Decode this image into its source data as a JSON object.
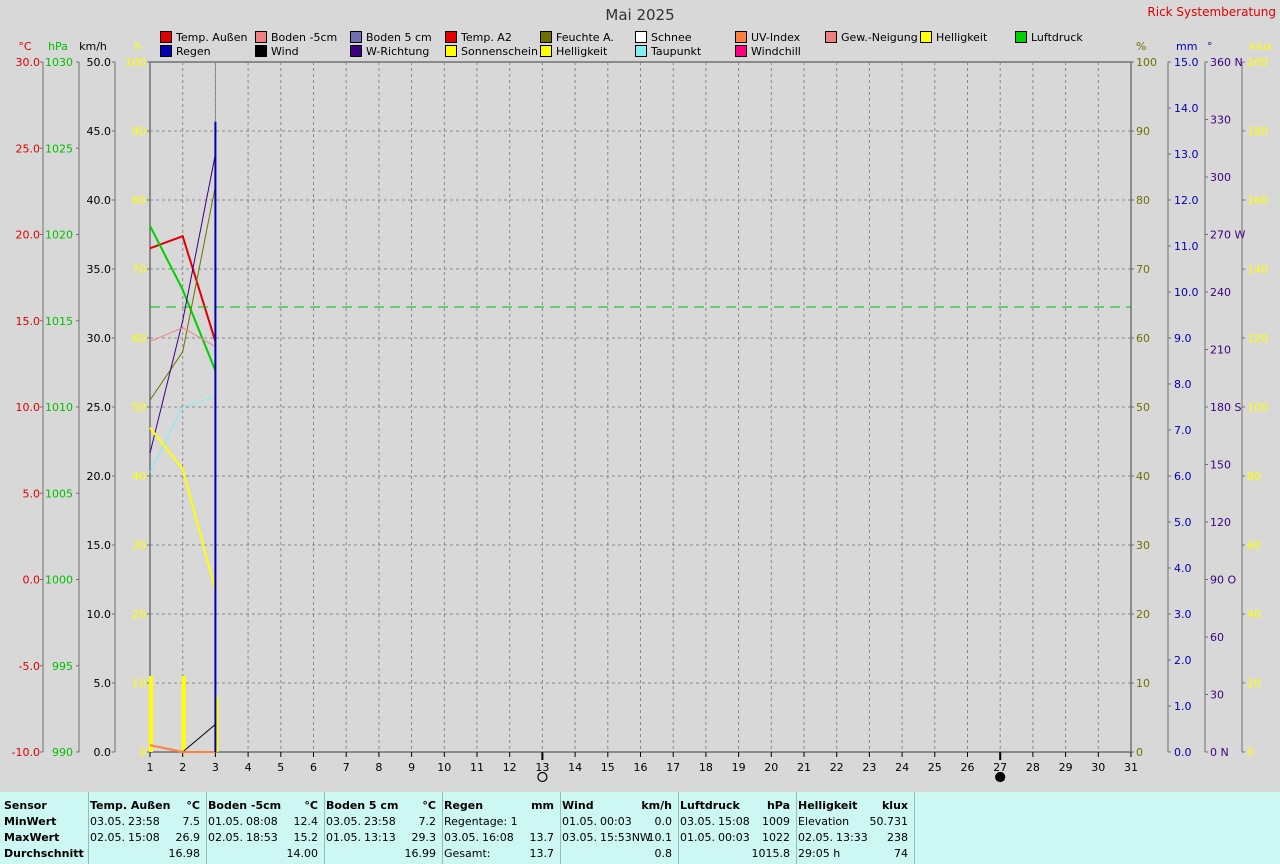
{
  "title": "Mai 2025",
  "brand": "Rick Systemberatung",
  "legend": [
    {
      "label": "Temp. Außen",
      "color": "#e00000"
    },
    {
      "label": "Regen",
      "color": "#0000b0"
    },
    {
      "label": "Boden -5cm",
      "color": "#f08080"
    },
    {
      "label": "Wind",
      "color": "#000000"
    },
    {
      "label": "Boden 5 cm",
      "color": "#7070b0"
    },
    {
      "label": "W-Richtung",
      "color": "#3c0080"
    },
    {
      "label": "Temp. A2",
      "color": "#e00000"
    },
    {
      "label": "Sonnenschein",
      "color": "#ffff00"
    },
    {
      "label": "Feuchte A.",
      "color": "#707000"
    },
    {
      "label": "Helligkeit",
      "color": "#ffff00"
    },
    {
      "label": "Schnee",
      "color": "#ffffff"
    },
    {
      "label": "Taupunkt",
      "color": "#80f0f0"
    },
    {
      "label": "UV-Index",
      "color": "#ff8040"
    },
    {
      "label": "Windchill",
      "color": "#ff0080"
    },
    {
      "label": "Gew.-Neigung",
      "color": "#f08080"
    },
    {
      "label": "Helligkeit",
      "color": "#ffff00"
    },
    {
      "label": "Luftdruck",
      "color": "#00d000"
    }
  ],
  "chart_data": {
    "type": "line",
    "title": "Mai 2025",
    "x": [
      1,
      2,
      3
    ],
    "x_ticks": [
      1,
      2,
      3,
      4,
      5,
      6,
      7,
      8,
      9,
      10,
      11,
      12,
      13,
      14,
      15,
      16,
      17,
      18,
      19,
      20,
      21,
      22,
      23,
      24,
      25,
      26,
      27,
      28,
      29,
      30,
      31
    ],
    "x_range": [
      1,
      31
    ],
    "grid": true,
    "moon_markers": [
      {
        "day": 13,
        "phase": "full"
      },
      {
        "day": 27,
        "phase": "new"
      }
    ],
    "axes": {
      "temp": {
        "unit": "°C",
        "range": [
          -10,
          30
        ],
        "ticks": [
          "30.0",
          "25.0",
          "20.0",
          "15.0",
          "10.0",
          "5.0",
          "0.0",
          "-5.0",
          "-10.0"
        ],
        "color": "#e00000"
      },
      "pressure": {
        "unit": "hPa",
        "range": [
          990,
          1030
        ],
        "ticks": [
          "1030",
          "1025",
          "1020",
          "1015",
          "1010",
          "1005",
          "1000",
          "995",
          "990"
        ],
        "color": "#00c000"
      },
      "wind": {
        "unit": "km/h",
        "range": [
          0,
          50
        ],
        "ticks": [
          "50.0",
          "45.0",
          "40.0",
          "35.0",
          "30.0",
          "25.0",
          "20.0",
          "15.0",
          "10.0",
          "5.0",
          "0.0"
        ],
        "color": "#000000"
      },
      "sun": {
        "unit": "h",
        "range": [
          0,
          100
        ],
        "ticks": [
          "100",
          "90",
          "80",
          "70",
          "60",
          "50",
          "40",
          "30",
          "20",
          "10",
          "0"
        ],
        "color": "#ffff00"
      },
      "humidity": {
        "unit": "%",
        "range": [
          0,
          100
        ],
        "ticks": [
          "100",
          "90",
          "80",
          "70",
          "60",
          "50",
          "40",
          "30",
          "20",
          "10",
          "0"
        ],
        "color": "#707000"
      },
      "rain": {
        "unit": "mm",
        "range": [
          0,
          15
        ],
        "ticks": [
          "15.0",
          "14.0",
          "13.0",
          "12.0",
          "11.0",
          "10.0",
          "9.0",
          "8.0",
          "7.0",
          "6.0",
          "5.0",
          "4.0",
          "3.0",
          "2.0",
          "1.0",
          "0.0"
        ],
        "color": "#0000b0"
      },
      "direction": {
        "unit": "°",
        "range": [
          0,
          360
        ],
        "ticks": [
          "360 N",
          "330",
          "300",
          "270 W",
          "240",
          "210",
          "180 S",
          "150",
          "120",
          "90  O",
          "60",
          "30",
          "0   N"
        ],
        "color": "#3c0080"
      },
      "brightness": {
        "unit": "klux",
        "range": [
          0,
          200
        ],
        "ticks": [
          "200",
          "180",
          "160",
          "140",
          "120",
          "100",
          "80",
          "60",
          "40",
          "20",
          "0"
        ],
        "color": "#ffff00"
      }
    },
    "series": [
      {
        "name": "Temp. Außen",
        "axis": "temp",
        "color": "#e00000",
        "width": 2,
        "values": [
          [
            1,
            19.2
          ],
          [
            2,
            19.9
          ],
          [
            3,
            13.8
          ]
        ]
      },
      {
        "name": "Luftdruck",
        "axis": "pressure",
        "color": "#00d000",
        "width": 2,
        "values": [
          [
            1,
            1020.5
          ],
          [
            2,
            1016.8
          ],
          [
            3,
            1012.1
          ]
        ]
      },
      {
        "name": "Luftdruck",
        "axis": "pressure",
        "color": "#00c000",
        "width": 1,
        "dash": "10,6",
        "values": [
          [
            1,
            1015.8
          ],
          [
            31,
            1015.8
          ]
        ]
      },
      {
        "name": "Feuchte A.",
        "axis": "humidity",
        "color": "#707000",
        "width": 1,
        "values": [
          [
            1,
            51
          ],
          [
            2,
            58
          ],
          [
            3,
            82
          ]
        ]
      },
      {
        "name": "W-Richtung",
        "axis": "direction",
        "color": "#3c0080",
        "width": 1,
        "values": [
          [
            1,
            156
          ],
          [
            2,
            225
          ],
          [
            3,
            312
          ]
        ]
      },
      {
        "name": "Boden -5cm",
        "axis": "temp",
        "color": "#f08080",
        "width": 1,
        "values": [
          [
            1,
            13.8
          ],
          [
            2,
            14.6
          ],
          [
            3,
            13.5
          ]
        ]
      },
      {
        "name": "Taupunkt",
        "axis": "temp",
        "color": "#80f0f0",
        "width": 1,
        "values": [
          [
            1,
            6.2
          ],
          [
            2,
            10.0
          ],
          [
            3,
            10.6
          ]
        ]
      },
      {
        "name": "Helligkeit",
        "axis": "brightness",
        "color": "#ffff00",
        "width": 2,
        "values": [
          [
            1,
            94
          ],
          [
            2,
            82
          ],
          [
            3,
            47
          ]
        ]
      },
      {
        "name": "Wind",
        "axis": "wind",
        "color": "#000000",
        "width": 1,
        "values": [
          [
            1,
            0.5
          ],
          [
            2,
            0.0
          ],
          [
            3,
            2.0
          ]
        ]
      },
      {
        "name": "UV-Index",
        "axis": "humidity",
        "color": "#ff8040",
        "width": 2,
        "values": [
          [
            1,
            1
          ],
          [
            2,
            0
          ],
          [
            3,
            0
          ]
        ]
      }
    ],
    "rain_total": {
      "name": "Regen",
      "axis": "rain",
      "color": "#0000b0",
      "values": [
        [
          3,
          13.7
        ]
      ]
    },
    "sunshine_bars": {
      "name": "Sonnenschein",
      "axis": "sun",
      "color": "#ffff00",
      "values": [
        [
          1,
          11
        ],
        [
          2,
          11
        ],
        [
          3,
          8
        ]
      ]
    }
  },
  "table": {
    "columns": [
      {
        "title": "Sensor",
        "unit": "",
        "rows": [
          "MinWert",
          "MaxWert",
          "Durchschnitt"
        ],
        "bold_rows": true
      },
      {
        "title": "Temp. Außen",
        "unit": "°C",
        "rows": [
          [
            "03.05.",
            "23:58",
            "7.5"
          ],
          [
            "02.05.",
            "15:08",
            "26.9"
          ],
          [
            "",
            "",
            "16.98"
          ]
        ]
      },
      {
        "title": "Boden -5cm",
        "unit": "°C",
        "rows": [
          [
            "01.05.",
            "08:08",
            "12.4"
          ],
          [
            "02.05.",
            "18:53",
            "15.2"
          ],
          [
            "",
            "",
            "14.00"
          ]
        ]
      },
      {
        "title": "Boden 5 cm",
        "unit": "°C",
        "rows": [
          [
            "03.05.",
            "23:58",
            "7.2"
          ],
          [
            "01.05.",
            "13:13",
            "29.3"
          ],
          [
            "",
            "",
            "16.99"
          ]
        ]
      },
      {
        "title": "Regen",
        "unit": "mm",
        "rows": [
          [
            "Regentage: 1",
            "",
            "",
            ""
          ],
          [
            "03.05.",
            "16:08",
            "13.7"
          ],
          [
            "Gesamt:",
            "",
            "13.7"
          ]
        ]
      },
      {
        "title": "Wind",
        "unit": "km/h",
        "rows": [
          [
            "01.05.",
            "00:03",
            "0.0"
          ],
          [
            "03.05.",
            "15:53NW",
            "10.1"
          ],
          [
            "",
            "",
            "0.8"
          ]
        ]
      },
      {
        "title": "Luftdruck",
        "unit": "hPa",
        "rows": [
          [
            "03.05.",
            "15:08",
            "1009"
          ],
          [
            "01.05.",
            "00:03",
            "1022"
          ],
          [
            "",
            "",
            "1015.8"
          ]
        ]
      },
      {
        "title": "Helligkeit",
        "unit": "klux",
        "rows": [
          [
            "Elevation",
            "",
            "50.731"
          ],
          [
            "02.05.",
            "13:33",
            "238"
          ],
          [
            "29:05 h",
            "",
            "74"
          ]
        ]
      }
    ]
  }
}
